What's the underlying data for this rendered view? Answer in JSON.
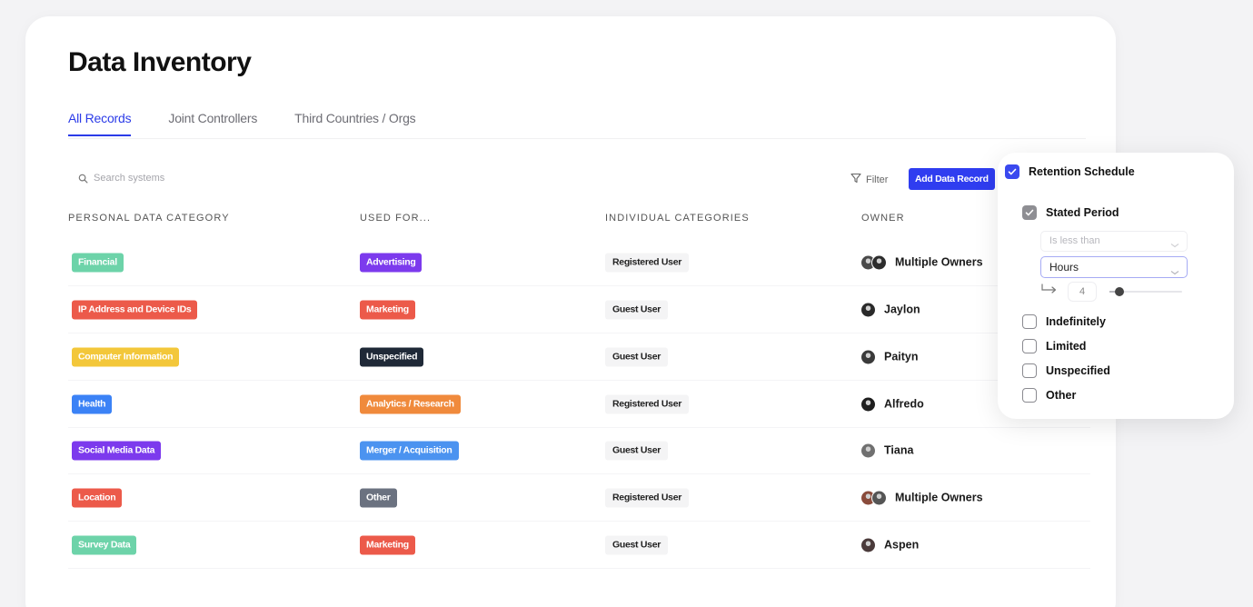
{
  "page": {
    "title": "Data Inventory",
    "tabs": [
      {
        "label": "All Records",
        "active": true
      },
      {
        "label": "Joint Controllers",
        "active": false
      },
      {
        "label": "Third Countries / Orgs",
        "active": false
      }
    ]
  },
  "toolbar": {
    "search_placeholder": "Search systems",
    "filter_label": "Filter",
    "add_label": "Add Data Record"
  },
  "table": {
    "headers": [
      "PERSONAL DATA CATEGORY",
      "USED FOR...",
      "INDIVIDUAL CATEGORIES",
      "OWNER"
    ],
    "rows": [
      {
        "category": "Financial",
        "category_color": "#6dd3a9",
        "used_for": "Advertising",
        "used_color": "#7c3aed",
        "individual": "Registered User",
        "owner": "Multiple Owners",
        "avatars": [
          "#4a4a4a",
          "#2d2d2d"
        ]
      },
      {
        "category": "IP Address and Device IDs",
        "category_color": "#ec5a4a",
        "used_for": "Marketing",
        "used_color": "#ec5a4a",
        "individual": "Guest User",
        "owner": "Jaylon",
        "avatars": [
          "#2a2a2a"
        ]
      },
      {
        "category": "Computer Information",
        "category_color": "#f3c73a",
        "used_for": "Unspecified",
        "used_color": "#1f2937",
        "individual": "Guest User",
        "owner": "Paityn",
        "avatars": [
          "#3a3a3a"
        ]
      },
      {
        "category": "Health",
        "category_color": "#3b82f6",
        "used_for": "Analytics / Research",
        "used_color": "#f08a3c",
        "individual": "Registered User",
        "owner": "Alfredo",
        "avatars": [
          "#1e1e1e"
        ]
      },
      {
        "category": "Social Media Data",
        "category_color": "#7c3aed",
        "used_for": "Merger / Acquisition",
        "used_color": "#4b93f0",
        "individual": "Guest User",
        "owner": "Tiana",
        "avatars": [
          "#707070"
        ]
      },
      {
        "category": "Location",
        "category_color": "#ec5a4a",
        "used_for": "Other",
        "used_color": "#6b7280",
        "individual": "Registered User",
        "owner": "Multiple Owners",
        "avatars": [
          "#8a4b3b",
          "#555555"
        ]
      },
      {
        "category": "Survey Data",
        "category_color": "#6dd3a9",
        "used_for": "Marketing",
        "used_color": "#ec5a4a",
        "individual": "Guest User",
        "owner": "Aspen",
        "avatars": [
          "#4a3a3a"
        ]
      }
    ]
  },
  "retention": {
    "title": "Retention Schedule",
    "stated_period_label": "Stated Period",
    "condition_value": "Is less than",
    "unit_value": "Hours",
    "amount_value": "4",
    "slider_fraction": 0.08,
    "options": [
      "Indefinitely",
      "Limited",
      "Unspecified",
      "Other"
    ]
  },
  "colors": {
    "accent": "#2b3be8",
    "button": "#2f3df0"
  }
}
